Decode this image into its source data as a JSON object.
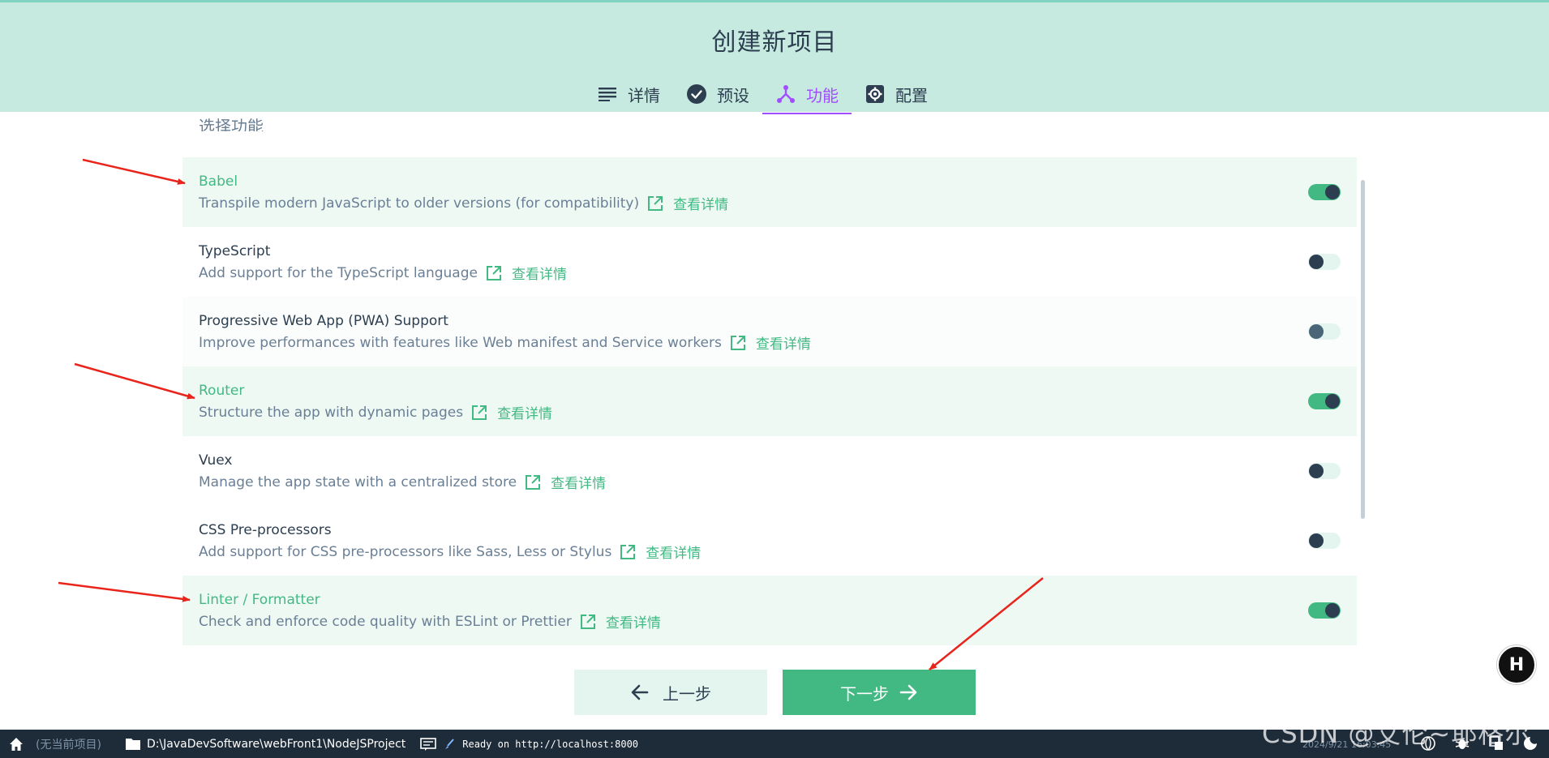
{
  "header": {
    "title": "创建新项目",
    "tabs": [
      {
        "label": "详情",
        "icon": "list-icon",
        "active": false
      },
      {
        "label": "预设",
        "icon": "check-circle-icon",
        "active": false
      },
      {
        "label": "功能",
        "icon": "fork-icon",
        "active": true
      },
      {
        "label": "配置",
        "icon": "gear-icon",
        "active": false
      }
    ]
  },
  "main": {
    "section_title": "选择功能",
    "details_link": "查看详情",
    "features": [
      {
        "name": "Babel",
        "desc": "Transpile modern JavaScript to older versions (for compatibility)",
        "state": "on"
      },
      {
        "name": "TypeScript",
        "desc": "Add support for the TypeScript language",
        "state": "off"
      },
      {
        "name": "Progressive Web App (PWA) Support",
        "desc": "Improve performances with features like Web manifest and Service workers",
        "state": "off-disabled"
      },
      {
        "name": "Router",
        "desc": "Structure the app with dynamic pages",
        "state": "on"
      },
      {
        "name": "Vuex",
        "desc": "Manage the app state with a centralized store",
        "state": "off"
      },
      {
        "name": "CSS Pre-processors",
        "desc": "Add support for CSS pre-processors like Sass, Less or Stylus",
        "state": "off"
      },
      {
        "name": "Linter / Formatter",
        "desc": "Check and enforce code quality with ESLint or Prettier",
        "state": "on"
      }
    ],
    "prev_label": "上一步",
    "next_label": "下一步"
  },
  "statusbar": {
    "no_project": "(无当前项目)",
    "path": "D:\\JavaDevSoftware\\webFront1\\NodeJSProject",
    "log": "Ready on http://localhost:8000",
    "datetime": "2024/9/21 16:03:45"
  },
  "watermark": "CSDN @艾伦~耶格尔",
  "colors": {
    "accent": "#42b983",
    "header_bg": "#c6eadf",
    "active_tab": "#a24dff",
    "statusbar_bg": "#1e2b38",
    "annotation": "#e8241b"
  }
}
